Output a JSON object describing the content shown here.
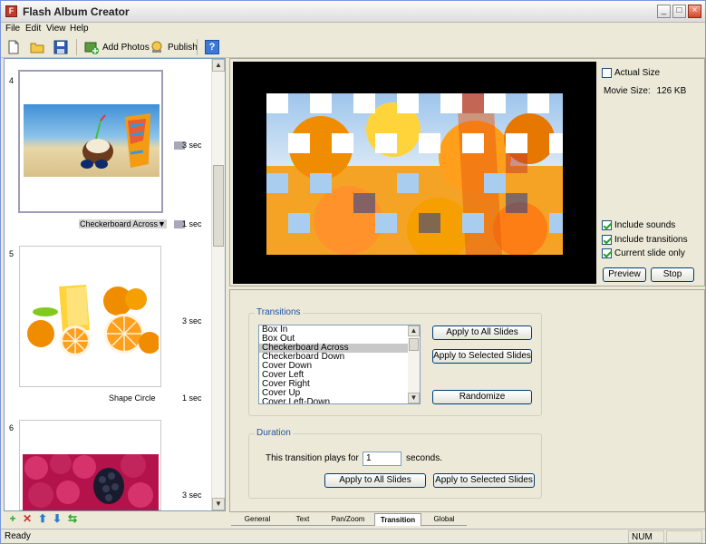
{
  "app": {
    "title": "Flash Album Creator"
  },
  "menu": [
    "File",
    "Edit",
    "View",
    "Help"
  ],
  "toolbar": {
    "add_photos": "Add Photos",
    "publish": "Publish"
  },
  "slides": [
    {
      "num": "4",
      "duration": "3 sec",
      "transition": "Checkerboard Across▼",
      "transition_duration": "1 sec"
    },
    {
      "num": "5",
      "duration": "3 sec",
      "transition": "Shape Circle",
      "transition_duration": "1 sec"
    },
    {
      "num": "6",
      "duration": "3 sec"
    }
  ],
  "preview": {
    "actual_size": "Actual Size",
    "movie_size_label": "Movie Size:",
    "movie_size_value": "126 KB",
    "include_sounds": "Include sounds",
    "include_transitions": "Include transitions",
    "current_slide_only": "Current slide only",
    "preview_btn": "Preview",
    "stop_btn": "Stop",
    "checked": {
      "actual_size": false,
      "include_sounds": true,
      "include_transitions": true,
      "current_slide_only": true
    }
  },
  "transitions": {
    "title": "Transitions",
    "items": [
      "Box In",
      "Box Out",
      "Checkerboard Across",
      "Checkerboard Down",
      "Cover Down",
      "Cover Left",
      "Cover Right",
      "Cover Up",
      "Cover Left-Down"
    ],
    "selected": "Checkerboard Across",
    "apply_all": "Apply to All Slides",
    "apply_selected": "Apply to Selected Slides",
    "randomize": "Randomize"
  },
  "duration": {
    "title": "Duration",
    "label_pre": "This transition plays for",
    "value": "1",
    "label_post": "seconds.",
    "apply_all": "Apply to All Slides",
    "apply_selected": "Apply to Selected Slides"
  },
  "tabs": [
    "General",
    "Text",
    "Pan/Zoom",
    "Transition",
    "Global"
  ],
  "active_tab": "Transition",
  "status": {
    "text": "Ready",
    "num": "NUM"
  }
}
